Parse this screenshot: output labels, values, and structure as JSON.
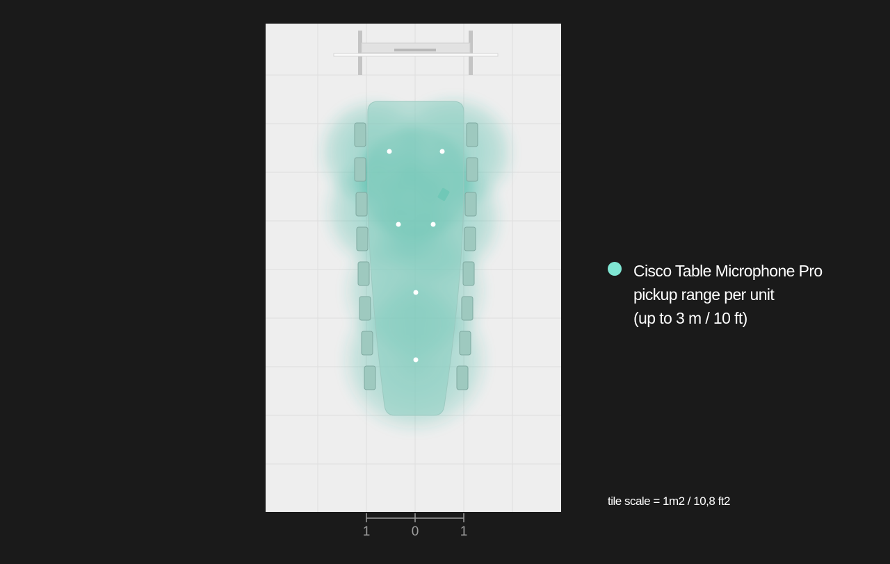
{
  "legend": {
    "color": "#7fe6d3",
    "line1": "Cisco Table Microphone Pro",
    "line2": "pickup range per unit",
    "line3": "(up to 3 m / 10 ft)"
  },
  "tile_scale": "tile scale = 1m2 / 10,8 ft2",
  "scale_bar": {
    "left_label": "1",
    "center_label": "0",
    "right_label": "1"
  },
  "colors": {
    "background": "#1a1a1a",
    "room_floor": "#eeeeee",
    "pickup_zone": "#2fb39c",
    "microphone": "#ffffff"
  },
  "microphones": {
    "count": 6
  }
}
